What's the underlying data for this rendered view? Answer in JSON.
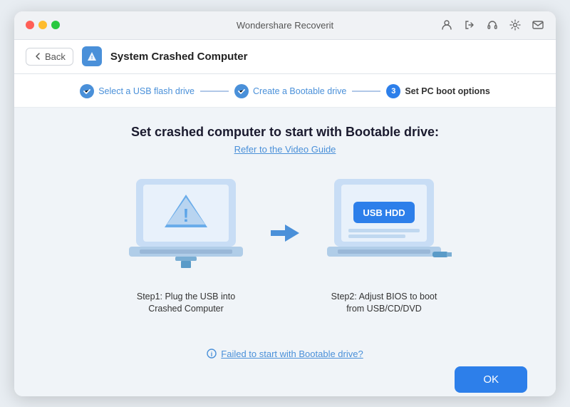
{
  "titlebar": {
    "title": "Wondershare Recoverit"
  },
  "navbar": {
    "back_label": "Back",
    "page_title": "System Crashed Computer"
  },
  "steps": [
    {
      "id": 1,
      "label": "Select a USB flash drive",
      "state": "done",
      "icon": "✓"
    },
    {
      "id": 2,
      "label": "Create a Bootable drive",
      "state": "done",
      "icon": "✓"
    },
    {
      "id": 3,
      "label": "Set PC boot options",
      "state": "active",
      "icon": "3"
    }
  ],
  "main": {
    "heading": "Set crashed computer to start with Bootable drive:",
    "video_guide": "Refer to the Video Guide",
    "step1_label": "Step1:  Plug the USB into Crashed Computer",
    "step2_label": "Step2: Adjust BIOS to boot from USB/CD/DVD",
    "usb_hdd_label": "USB HDD",
    "failed_link": "Failed to start with Bootable drive?",
    "ok_label": "OK"
  },
  "icons": {
    "warning": "⚠",
    "info": "ℹ"
  }
}
